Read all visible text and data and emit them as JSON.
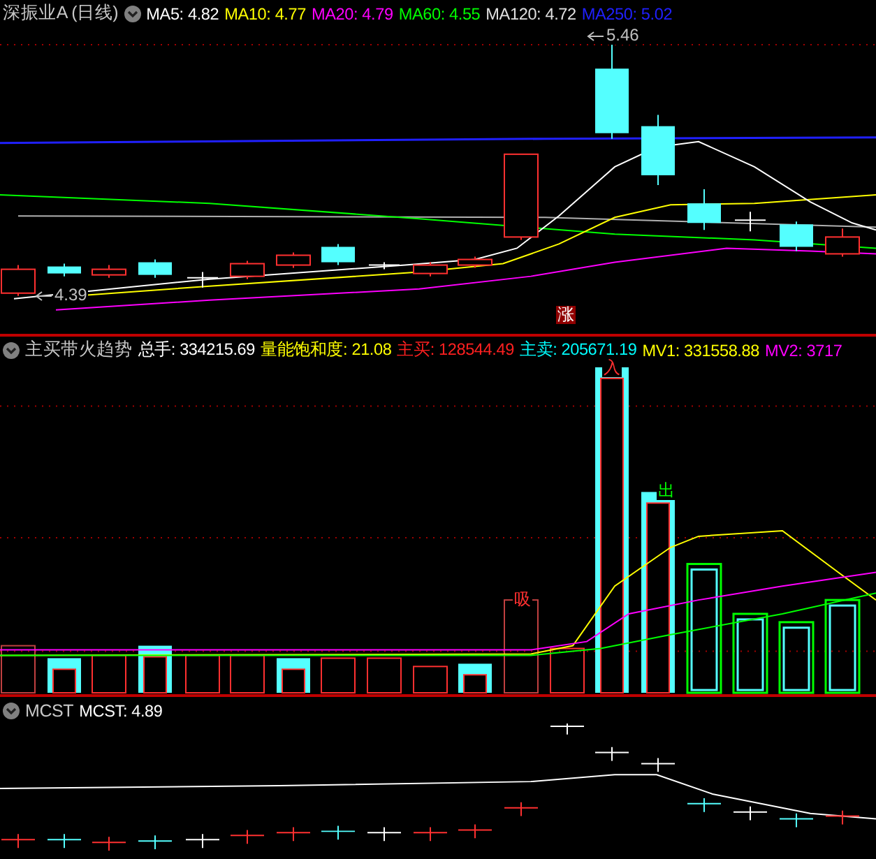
{
  "panels": [
    {
      "kind": "candles",
      "header": [
        {
          "kind": "title",
          "text": "深振业A (日线)"
        },
        {
          "kind": "toggle"
        },
        {
          "kind": "indicator",
          "text": "MA5: 4.82",
          "color": "#ffffff"
        },
        {
          "kind": "indicator",
          "text": "MA10: 4.77",
          "color": "#ffff00"
        },
        {
          "kind": "indicator",
          "text": "MA20: 4.79",
          "color": "#ff00ff"
        },
        {
          "kind": "indicator",
          "text": "MA60: 4.55",
          "color": "#00ff00"
        },
        {
          "kind": "indicator",
          "text": "MA120: 4.72",
          "color": "#e0e0e0"
        },
        {
          "kind": "indicator",
          "text": "MA250: 5.02",
          "color": "#2020ff"
        }
      ],
      "marks": [
        "5.46",
        "4.39",
        "涨"
      ]
    },
    {
      "kind": "volume",
      "header": [
        {
          "kind": "toggle"
        },
        {
          "kind": "title",
          "text": "主买带火趋势"
        },
        {
          "kind": "indicator",
          "text": "总手: 334215.69",
          "color": "#ffffff"
        },
        {
          "kind": "indicator",
          "text": "量能饱和度: 21.08",
          "color": "#ffff00"
        },
        {
          "kind": "indicator",
          "text": "主买: 128544.49",
          "color": "#ff2020"
        },
        {
          "kind": "indicator",
          "text": "主卖: 205671.19",
          "color": "#00ffff"
        },
        {
          "kind": "indicator",
          "text": "MV1: 331558.88",
          "color": "#ffff00"
        },
        {
          "kind": "indicator",
          "text": "MV2: 3717",
          "color": "#ff00ff"
        }
      ],
      "marks": [
        "入",
        "出",
        "吸"
      ]
    },
    {
      "kind": "mcst",
      "header": [
        {
          "kind": "toggle"
        },
        {
          "kind": "title",
          "text": "MCST"
        },
        {
          "kind": "indicator",
          "text": "MCST: 4.89",
          "color": "#ffffff"
        }
      ]
    }
  ]
}
